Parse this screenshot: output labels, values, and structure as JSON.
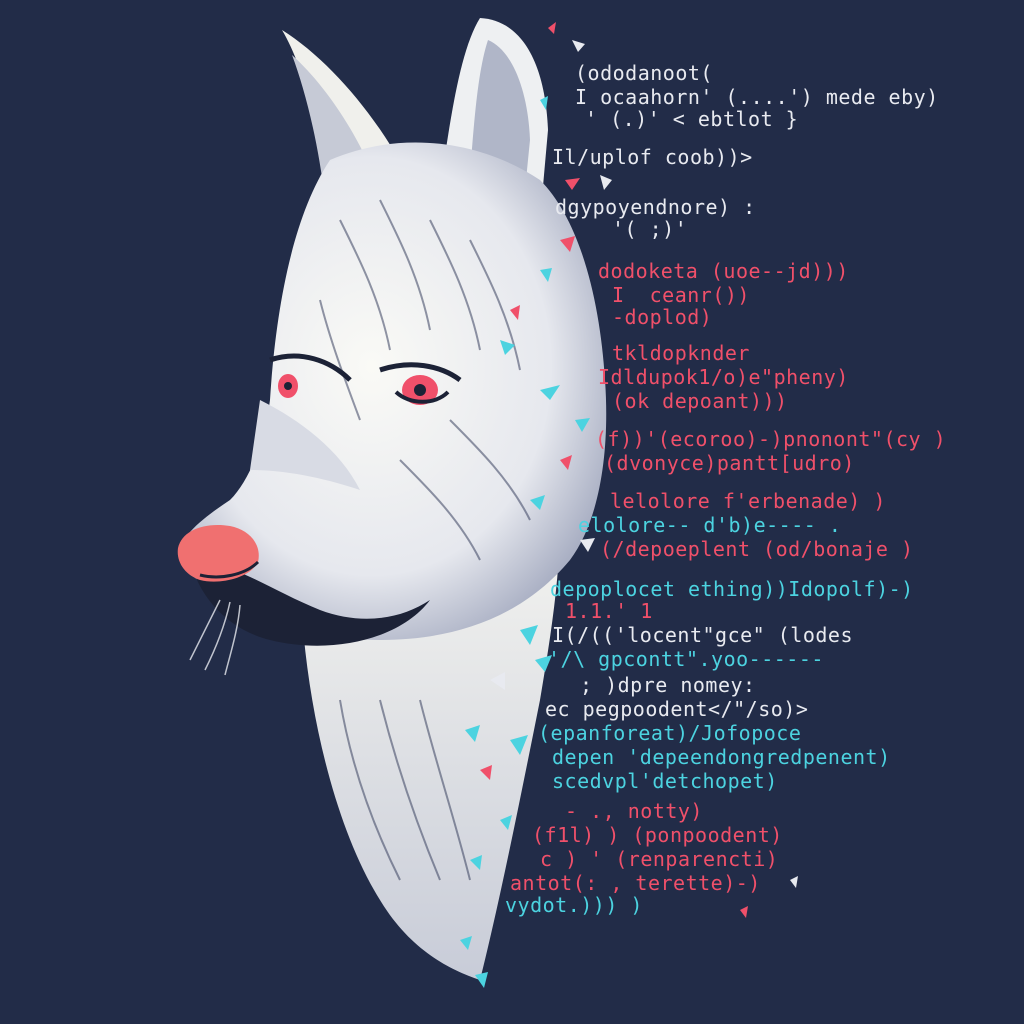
{
  "scene": {
    "background": "#222c48",
    "subject": "wolf-head",
    "fur_color": "#f2f2ee",
    "shadow_color": "#1c2236",
    "eye_color": "#f0506a",
    "nose_color": "#f07070",
    "accent_cyan": "#4cd3e0",
    "accent_red": "#f0506a"
  },
  "code_lines": [
    {
      "text": "(ododanoot(",
      "color": "white"
    },
    {
      "text": "I ocaahorn' (....') mede eby)",
      "color": "white"
    },
    {
      "text": "' (.)' < ebtlot }",
      "color": "white"
    },
    {
      "text": "Il/uplof coob))>",
      "color": "white"
    },
    {
      "text": "dgypoyendnore) :",
      "color": "white"
    },
    {
      "text": "'( ;)'",
      "color": "white"
    },
    {
      "text": "dodoketa (uoe--jd)))",
      "color": "red"
    },
    {
      "text": "I  ceanr())",
      "color": "red"
    },
    {
      "text": "-doplod)",
      "color": "red"
    },
    {
      "text": "tkldopknder",
      "color": "red"
    },
    {
      "text": "Idldupok1/o)e\"pheny)",
      "color": "red"
    },
    {
      "text": "(ok depoant)))",
      "color": "red"
    },
    {
      "text": "(f))'(ecoroo)-)pnonont\"(cy )",
      "color": "red"
    },
    {
      "text": "(dvonyce)pantt[udro)",
      "color": "red"
    },
    {
      "text": "lelolore f'erbenade) )",
      "color": "red"
    },
    {
      "text": "elolore-- d'b)e---- .",
      "color": "cyan"
    },
    {
      "text": "(/depoeplent (od/bonaje )",
      "color": "red"
    },
    {
      "text": "depoplocet ething))Idopolf)-)",
      "color": "cyan"
    },
    {
      "text": "1.1.' 1",
      "color": "red"
    },
    {
      "text": "I(/(('locent\"gce\" (lodes",
      "color": "white"
    },
    {
      "text": "'/\\ gpcontt\".yoo------",
      "color": "cyan"
    },
    {
      "text": "; )dpre nomey:",
      "color": "white"
    },
    {
      "text": "ec pegpoodent</\"/so)>",
      "color": "white"
    },
    {
      "text": "(epanforeat)/Jofopoce",
      "color": "cyan"
    },
    {
      "text": "depen 'depeendongredpenent)",
      "color": "cyan"
    },
    {
      "text": "scedvpl'detchopet)",
      "color": "cyan"
    },
    {
      "text": "- ., notty)",
      "color": "red"
    },
    {
      "text": "(f1l) ) (ponpoodent)",
      "color": "red"
    },
    {
      "text": "c ) ' (renparencti)",
      "color": "red"
    },
    {
      "text": "antot(: , terette)-)",
      "color": "red"
    },
    {
      "text": "vydot.))) )",
      "color": "cyan"
    }
  ]
}
